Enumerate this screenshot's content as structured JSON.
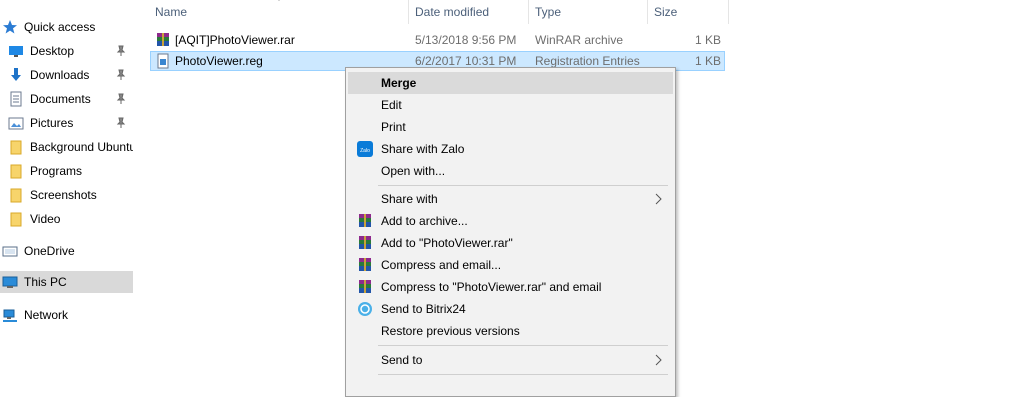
{
  "nav": {
    "quick_access": "Quick access",
    "desktop": "Desktop",
    "downloads": "Downloads",
    "documents": "Documents",
    "pictures": "Pictures",
    "background_ubuntu": "Background Ubuntu",
    "programs": "Programs",
    "screenshots": "Screenshots",
    "video": "Video",
    "onedrive": "OneDrive",
    "this_pc": "This PC",
    "network": "Network"
  },
  "columns": {
    "name": "Name",
    "date_modified": "Date modified",
    "type": "Type",
    "size": "Size"
  },
  "files": [
    {
      "name": "[AQIT]PhotoViewer.rar",
      "date": "5/13/2018 9:56 PM",
      "type": "WinRAR archive",
      "size": "1 KB"
    },
    {
      "name": "PhotoViewer.reg",
      "date": "6/2/2017 10:31 PM",
      "type": "Registration Entries",
      "size": "1 KB"
    }
  ],
  "context_menu": {
    "merge": "Merge",
    "edit": "Edit",
    "print": "Print",
    "share_with_zalo": "Share with Zalo",
    "open_with": "Open with...",
    "share_with": "Share with",
    "add_to_archive": "Add to archive...",
    "add_to_rar": "Add to \"PhotoViewer.rar\"",
    "compress_email": "Compress and email...",
    "compress_rar_email": "Compress to \"PhotoViewer.rar\" and email",
    "send_to_bitrix": "Send to Bitrix24",
    "restore_versions": "Restore previous versions",
    "send_to": "Send to",
    "zalo_icon_text": "Zalo"
  },
  "colors": {
    "selected_row": "#cce8ff",
    "nav_selected": "#d9d9d9",
    "menu_bg": "#f2f2f2",
    "header_text": "#4c607a",
    "folder_yellow": "#f7d46b",
    "qa_star": "#2b7cd3"
  }
}
